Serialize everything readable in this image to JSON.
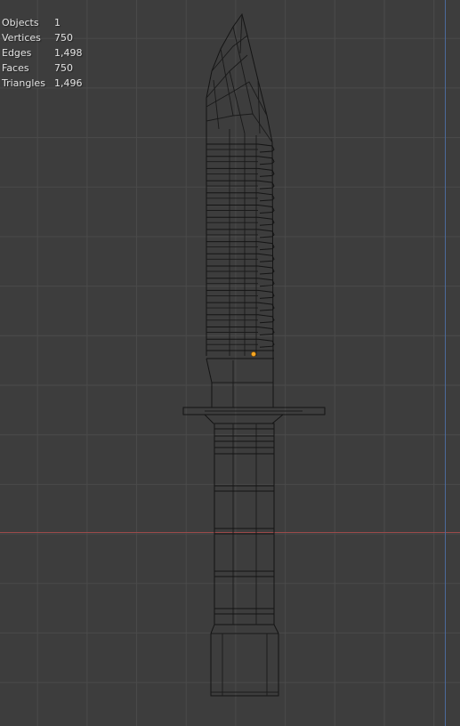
{
  "viewport": {
    "grid_color": "#4a4a4a",
    "background_color": "#3d3d3d",
    "x_axis_color": "#9b4a4a",
    "y_axis_color": "#4b6a9c",
    "wire_color": "#141414",
    "origin_color": "#f5a623"
  },
  "stats": [
    {
      "label": "Objects",
      "value": "1"
    },
    {
      "label": "Vertices",
      "value": "750"
    },
    {
      "label": "Edges",
      "value": "1,498"
    },
    {
      "label": "Faces",
      "value": "750"
    },
    {
      "label": "Triangles",
      "value": "1,496"
    }
  ]
}
